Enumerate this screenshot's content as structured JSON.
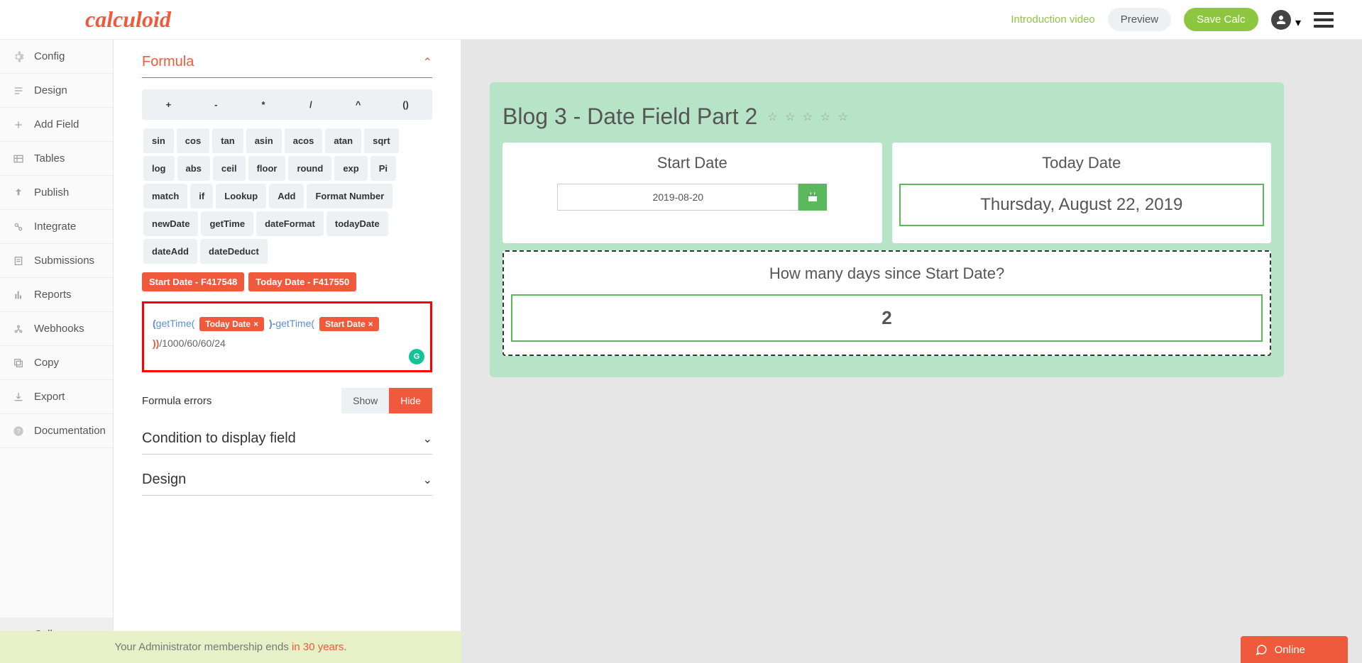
{
  "header": {
    "logo": "calculoid",
    "intro_link": "Introduction video",
    "preview_btn": "Preview",
    "save_btn": "Save Calc"
  },
  "sidebar": {
    "items": [
      {
        "icon": "gear",
        "label": "Config"
      },
      {
        "icon": "design",
        "label": "Design"
      },
      {
        "icon": "plus",
        "label": "Add Field"
      },
      {
        "icon": "table",
        "label": "Tables"
      },
      {
        "icon": "publish",
        "label": "Publish"
      },
      {
        "icon": "integrate",
        "label": "Integrate"
      },
      {
        "icon": "submissions",
        "label": "Submissions"
      },
      {
        "icon": "reports",
        "label": "Reports"
      },
      {
        "icon": "webhooks",
        "label": "Webhooks"
      },
      {
        "icon": "copy",
        "label": "Copy"
      },
      {
        "icon": "export",
        "label": "Export"
      },
      {
        "icon": "doc",
        "label": "Documentation"
      }
    ],
    "collapse": "Collapse menu"
  },
  "editor": {
    "section_title": "Formula",
    "operators": [
      "+",
      "-",
      "*",
      "/",
      "^",
      "()"
    ],
    "functions": [
      "sin",
      "cos",
      "tan",
      "asin",
      "acos",
      "atan",
      "sqrt",
      "log",
      "abs",
      "ceil",
      "floor",
      "round",
      "exp",
      "Pi",
      "match",
      "if",
      "Lookup",
      "Add",
      "Format Number",
      "newDate",
      "getTime",
      "dateFormat",
      "todayDate",
      "dateAdd",
      "dateDeduct"
    ],
    "field_chips": [
      "Start Date - F417548",
      "Today Date - F417550"
    ],
    "formula_tokens": {
      "open1": "(",
      "fn1": "getTime(",
      "tag1": "Today Date",
      "close1": ")",
      "dash": "-",
      "fn2": "getTime(",
      "tag2": "Start Date",
      "close2": ")",
      "tail": "/1000/60/60/24"
    },
    "errors_label": "Formula errors",
    "show": "Show",
    "hide": "Hide",
    "condition_title": "Condition to display field",
    "design_title": "Design"
  },
  "preview": {
    "title": "Blog 3 - Date Field Part 2",
    "start_label": "Start Date",
    "start_value": "2019-08-20",
    "today_label": "Today Date",
    "today_value": "Thursday, August 22, 2019",
    "result_label": "How many days since Start Date?",
    "result_value": "2"
  },
  "footer": {
    "text_a": "Your Administrator membership ends ",
    "text_b": "in 30 years",
    "text_c": "."
  },
  "online": "Online"
}
